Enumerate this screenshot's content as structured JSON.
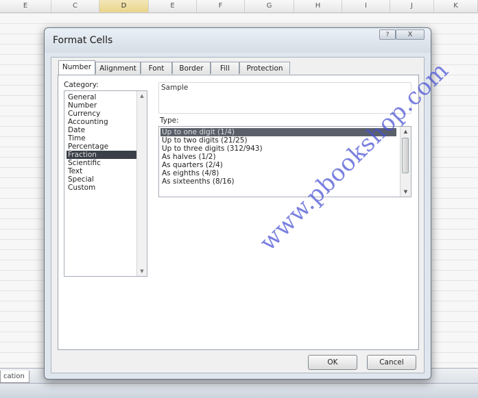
{
  "spreadsheet": {
    "columns": [
      "E",
      "C",
      "D",
      "E",
      "F",
      "G",
      "H",
      "I",
      "J",
      "K"
    ],
    "selected_column": "D",
    "sheet_tab_label": "cation"
  },
  "dialog": {
    "title": "Format Cells",
    "help_label": "?",
    "close_label": "X",
    "tabs": [
      {
        "label": "Number",
        "active": true
      },
      {
        "label": "Alignment",
        "active": false
      },
      {
        "label": "Font",
        "active": false
      },
      {
        "label": "Border",
        "active": false
      },
      {
        "label": "Fill",
        "active": false
      },
      {
        "label": "Protection",
        "active": false
      }
    ],
    "category_label": "Category:",
    "categories": [
      "General",
      "Number",
      "Currency",
      "Accounting",
      "Date",
      "Time",
      "Percentage",
      "Fraction",
      "Scientific",
      "Text",
      "Special",
      "Custom"
    ],
    "selected_category": "Fraction",
    "sample_label": "Sample",
    "type_label": "Type:",
    "types": [
      "Up to one digit (1/4)",
      "Up to two digits (21/25)",
      "Up to three digits (312/943)",
      "As halves (1/2)",
      "As quarters (2/4)",
      "As eighths (4/8)",
      "As sixteenths (8/16)"
    ],
    "selected_type": "Up to one digit (1/4)",
    "ok_label": "OK",
    "cancel_label": "Cancel"
  },
  "icons": {
    "scroll_up": "scroll-up-icon",
    "scroll_down": "scroll-down-icon"
  },
  "watermark": "www.pbookshop.com",
  "colors": {
    "selection": "#3a3f48",
    "watermark": "#4650d2",
    "dialog_frame": "#dfe6ee"
  }
}
